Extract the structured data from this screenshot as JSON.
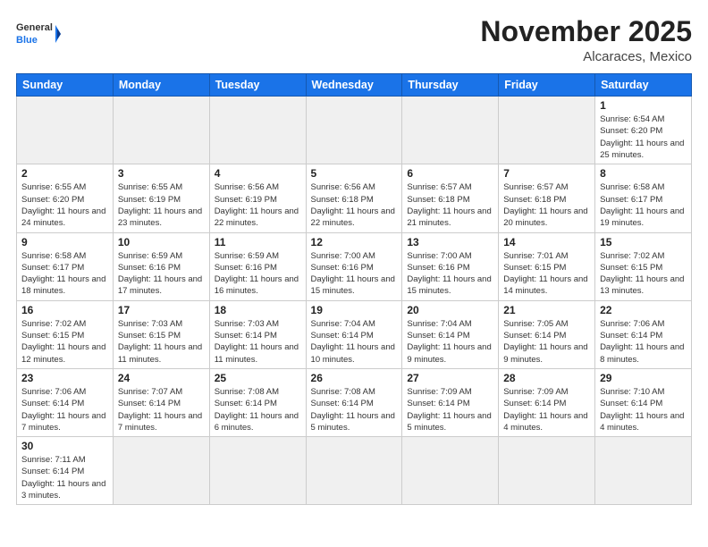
{
  "header": {
    "logo_general": "General",
    "logo_blue": "Blue",
    "month_title": "November 2025",
    "location": "Alcaraces, Mexico"
  },
  "days_of_week": [
    "Sunday",
    "Monday",
    "Tuesday",
    "Wednesday",
    "Thursday",
    "Friday",
    "Saturday"
  ],
  "weeks": [
    [
      {
        "day": "",
        "empty": true
      },
      {
        "day": "",
        "empty": true
      },
      {
        "day": "",
        "empty": true
      },
      {
        "day": "",
        "empty": true
      },
      {
        "day": "",
        "empty": true
      },
      {
        "day": "",
        "empty": true
      },
      {
        "day": "1",
        "sunrise": "Sunrise: 6:54 AM",
        "sunset": "Sunset: 6:20 PM",
        "daylight": "Daylight: 11 hours and 25 minutes."
      }
    ],
    [
      {
        "day": "2",
        "sunrise": "Sunrise: 6:55 AM",
        "sunset": "Sunset: 6:20 PM",
        "daylight": "Daylight: 11 hours and 24 minutes."
      },
      {
        "day": "3",
        "sunrise": "Sunrise: 6:55 AM",
        "sunset": "Sunset: 6:19 PM",
        "daylight": "Daylight: 11 hours and 23 minutes."
      },
      {
        "day": "4",
        "sunrise": "Sunrise: 6:56 AM",
        "sunset": "Sunset: 6:19 PM",
        "daylight": "Daylight: 11 hours and 22 minutes."
      },
      {
        "day": "5",
        "sunrise": "Sunrise: 6:56 AM",
        "sunset": "Sunset: 6:18 PM",
        "daylight": "Daylight: 11 hours and 22 minutes."
      },
      {
        "day": "6",
        "sunrise": "Sunrise: 6:57 AM",
        "sunset": "Sunset: 6:18 PM",
        "daylight": "Daylight: 11 hours and 21 minutes."
      },
      {
        "day": "7",
        "sunrise": "Sunrise: 6:57 AM",
        "sunset": "Sunset: 6:18 PM",
        "daylight": "Daylight: 11 hours and 20 minutes."
      },
      {
        "day": "8",
        "sunrise": "Sunrise: 6:58 AM",
        "sunset": "Sunset: 6:17 PM",
        "daylight": "Daylight: 11 hours and 19 minutes."
      }
    ],
    [
      {
        "day": "9",
        "sunrise": "Sunrise: 6:58 AM",
        "sunset": "Sunset: 6:17 PM",
        "daylight": "Daylight: 11 hours and 18 minutes."
      },
      {
        "day": "10",
        "sunrise": "Sunrise: 6:59 AM",
        "sunset": "Sunset: 6:16 PM",
        "daylight": "Daylight: 11 hours and 17 minutes."
      },
      {
        "day": "11",
        "sunrise": "Sunrise: 6:59 AM",
        "sunset": "Sunset: 6:16 PM",
        "daylight": "Daylight: 11 hours and 16 minutes."
      },
      {
        "day": "12",
        "sunrise": "Sunrise: 7:00 AM",
        "sunset": "Sunset: 6:16 PM",
        "daylight": "Daylight: 11 hours and 15 minutes."
      },
      {
        "day": "13",
        "sunrise": "Sunrise: 7:00 AM",
        "sunset": "Sunset: 6:16 PM",
        "daylight": "Daylight: 11 hours and 15 minutes."
      },
      {
        "day": "14",
        "sunrise": "Sunrise: 7:01 AM",
        "sunset": "Sunset: 6:15 PM",
        "daylight": "Daylight: 11 hours and 14 minutes."
      },
      {
        "day": "15",
        "sunrise": "Sunrise: 7:02 AM",
        "sunset": "Sunset: 6:15 PM",
        "daylight": "Daylight: 11 hours and 13 minutes."
      }
    ],
    [
      {
        "day": "16",
        "sunrise": "Sunrise: 7:02 AM",
        "sunset": "Sunset: 6:15 PM",
        "daylight": "Daylight: 11 hours and 12 minutes."
      },
      {
        "day": "17",
        "sunrise": "Sunrise: 7:03 AM",
        "sunset": "Sunset: 6:15 PM",
        "daylight": "Daylight: 11 hours and 11 minutes."
      },
      {
        "day": "18",
        "sunrise": "Sunrise: 7:03 AM",
        "sunset": "Sunset: 6:14 PM",
        "daylight": "Daylight: 11 hours and 11 minutes."
      },
      {
        "day": "19",
        "sunrise": "Sunrise: 7:04 AM",
        "sunset": "Sunset: 6:14 PM",
        "daylight": "Daylight: 11 hours and 10 minutes."
      },
      {
        "day": "20",
        "sunrise": "Sunrise: 7:04 AM",
        "sunset": "Sunset: 6:14 PM",
        "daylight": "Daylight: 11 hours and 9 minutes."
      },
      {
        "day": "21",
        "sunrise": "Sunrise: 7:05 AM",
        "sunset": "Sunset: 6:14 PM",
        "daylight": "Daylight: 11 hours and 9 minutes."
      },
      {
        "day": "22",
        "sunrise": "Sunrise: 7:06 AM",
        "sunset": "Sunset: 6:14 PM",
        "daylight": "Daylight: 11 hours and 8 minutes."
      }
    ],
    [
      {
        "day": "23",
        "sunrise": "Sunrise: 7:06 AM",
        "sunset": "Sunset: 6:14 PM",
        "daylight": "Daylight: 11 hours and 7 minutes."
      },
      {
        "day": "24",
        "sunrise": "Sunrise: 7:07 AM",
        "sunset": "Sunset: 6:14 PM",
        "daylight": "Daylight: 11 hours and 7 minutes."
      },
      {
        "day": "25",
        "sunrise": "Sunrise: 7:08 AM",
        "sunset": "Sunset: 6:14 PM",
        "daylight": "Daylight: 11 hours and 6 minutes."
      },
      {
        "day": "26",
        "sunrise": "Sunrise: 7:08 AM",
        "sunset": "Sunset: 6:14 PM",
        "daylight": "Daylight: 11 hours and 5 minutes."
      },
      {
        "day": "27",
        "sunrise": "Sunrise: 7:09 AM",
        "sunset": "Sunset: 6:14 PM",
        "daylight": "Daylight: 11 hours and 5 minutes."
      },
      {
        "day": "28",
        "sunrise": "Sunrise: 7:09 AM",
        "sunset": "Sunset: 6:14 PM",
        "daylight": "Daylight: 11 hours and 4 minutes."
      },
      {
        "day": "29",
        "sunrise": "Sunrise: 7:10 AM",
        "sunset": "Sunset: 6:14 PM",
        "daylight": "Daylight: 11 hours and 4 minutes."
      }
    ],
    [
      {
        "day": "30",
        "sunrise": "Sunrise: 7:11 AM",
        "sunset": "Sunset: 6:14 PM",
        "daylight": "Daylight: 11 hours and 3 minutes."
      },
      {
        "day": "",
        "empty": true
      },
      {
        "day": "",
        "empty": true
      },
      {
        "day": "",
        "empty": true
      },
      {
        "day": "",
        "empty": true
      },
      {
        "day": "",
        "empty": true
      },
      {
        "day": "",
        "empty": true
      }
    ]
  ]
}
